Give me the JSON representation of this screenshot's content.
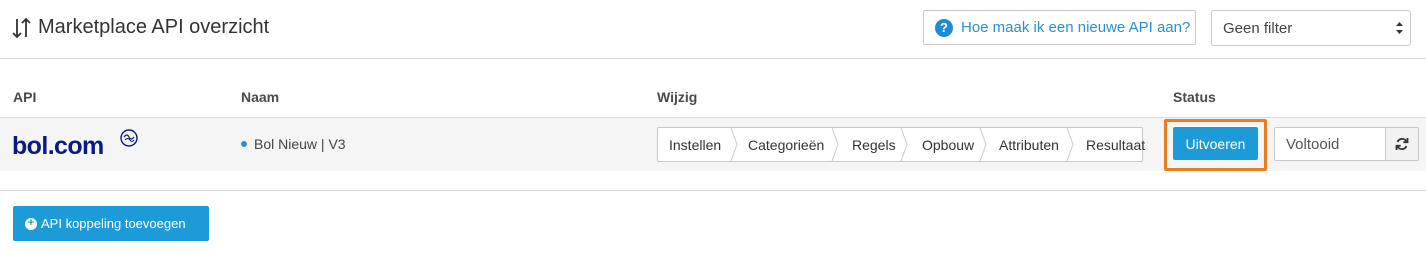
{
  "header": {
    "title": "Marketplace API overzicht",
    "help_label": "Hoe maak ik een nieuwe API aan?",
    "filter": {
      "selected": "Geen filter"
    }
  },
  "table": {
    "columns": {
      "api": "API",
      "naam": "Naam",
      "wijzig": "Wijzig",
      "status": "Status"
    },
    "rows": [
      {
        "logo_text": "bol.com",
        "naam": "Bol Nieuw | V3",
        "steps": [
          "Instellen",
          "Categorieën",
          "Regels",
          "Opbouw",
          "Attributen",
          "Resultaat"
        ],
        "run_label": "Uitvoeren",
        "status_value": "Voltooid"
      }
    ]
  },
  "footer": {
    "add_label": "API koppeling toevoegen"
  },
  "colors": {
    "accent": "#1d9bd8",
    "highlight": "#e67e22",
    "link": "#2a8fd4",
    "logo": "#0a1a80"
  }
}
